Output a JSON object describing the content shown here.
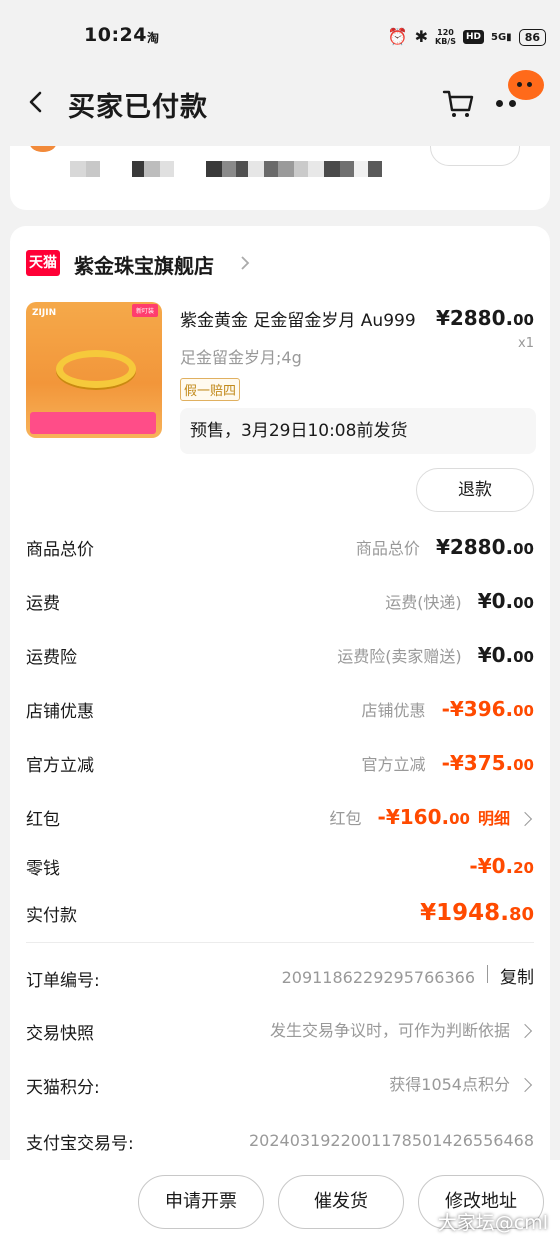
{
  "status_bar": {
    "time": "10:24",
    "app_indicator": "淘",
    "speed_value": "120",
    "speed_unit": "KB/S",
    "hd": "HD",
    "signal": "5G",
    "battery": "86"
  },
  "nav": {
    "title": "买家已付款",
    "back_icon": "chevron-left-icon",
    "cart_icon": "cart-icon",
    "more_icon": "more-icon"
  },
  "shop": {
    "logo_text": "天猫",
    "name": "紫金珠宝旗舰店"
  },
  "product": {
    "image_brand": "ZIJIN",
    "image_tag": "新叮装",
    "title": "紫金黄金 足金留金岁月 Au999",
    "price_main": "¥2880.",
    "price_cents": "00",
    "quantity": "x1",
    "sku": "足金留金岁月;4g",
    "guarantee_badge": "假一赔四",
    "presale_note": "预售，3月29日10:08前发货",
    "refund_label": "退款"
  },
  "price_rows": [
    {
      "label": "商品总价",
      "hint": "商品总价",
      "amount_main": "¥2880.",
      "amount_cents": "00"
    },
    {
      "label": "运费",
      "hint": "运费(快递)",
      "amount_main": "¥0.",
      "amount_cents": "00"
    },
    {
      "label": "运费险",
      "hint": "运费险(卖家赠送)",
      "amount_main": "¥0.",
      "amount_cents": "00"
    },
    {
      "label": "店铺优惠",
      "hint": "店铺优惠",
      "amount_main": "-¥396.",
      "amount_cents": "00"
    },
    {
      "label": "官方立减",
      "hint": "官方立减",
      "amount_main": "-¥375.",
      "amount_cents": "00"
    },
    {
      "label": "红包",
      "hint": "红包",
      "amount_main": "-¥160.",
      "amount_cents": "00",
      "link": "明细"
    },
    {
      "label": "零钱",
      "hint": "",
      "amount_main": "-¥0.",
      "amount_cents": "20"
    }
  ],
  "total": {
    "label": "实付款",
    "amount_main": "¥1948.",
    "amount_cents": "80"
  },
  "order_info": {
    "order_no_label": "订单编号:",
    "order_no": "2091186229295766366",
    "copy_label": "复制",
    "snapshot_label": "交易快照",
    "snapshot_hint": "发生交易争议时，可作为判断依据",
    "points_label": "天猫积分:",
    "points_value": "获得1054点积分",
    "alipay_label": "支付宝交易号:",
    "alipay_no": "2024031922001178501426556468"
  },
  "bottom_actions": [
    "申请开票",
    "催发货",
    "修改地址"
  ],
  "watermark": "大家坛@cml",
  "colors": {
    "accent": "#ff4a00",
    "tmall_red": "#ff0036",
    "gold": "#f6c93b"
  }
}
